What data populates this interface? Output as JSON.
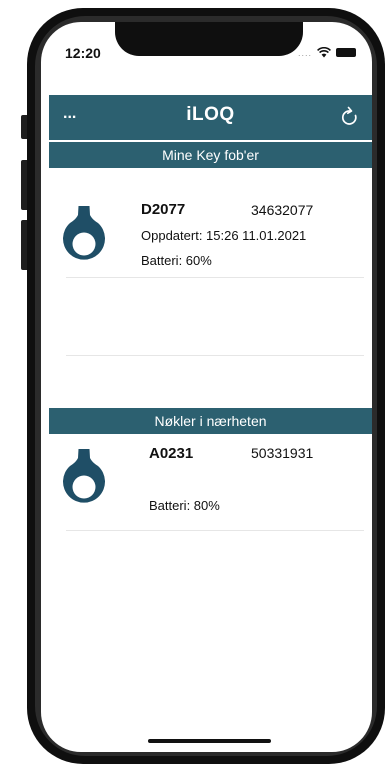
{
  "status_bar": {
    "time": "12:20",
    "dots": "....",
    "wifi_icon": "wifi-icon",
    "battery_icon": "battery-icon"
  },
  "header": {
    "menu": "...",
    "app_name": "iLOQ",
    "refresh_icon": "refresh-icon"
  },
  "sections": {
    "my_key_fobs": {
      "title": "Mine Key fob'er"
    },
    "nearby_keys": {
      "title": "Nøkler i nærheten"
    }
  },
  "my_fobs": [
    {
      "icon": "key-fob-icon",
      "name": "D2077",
      "serial": "34632077",
      "updated": "Oppdatert: 15:26 11.01.2021",
      "battery": "Batteri: 60%"
    }
  ],
  "nearby_fobs": [
    {
      "icon": "key-fob-icon",
      "name": "A0231",
      "serial": "50331931",
      "battery": "Batteri: 80%"
    }
  ],
  "colors": {
    "accent": "#2c6070",
    "fob": "#1f4e66"
  }
}
